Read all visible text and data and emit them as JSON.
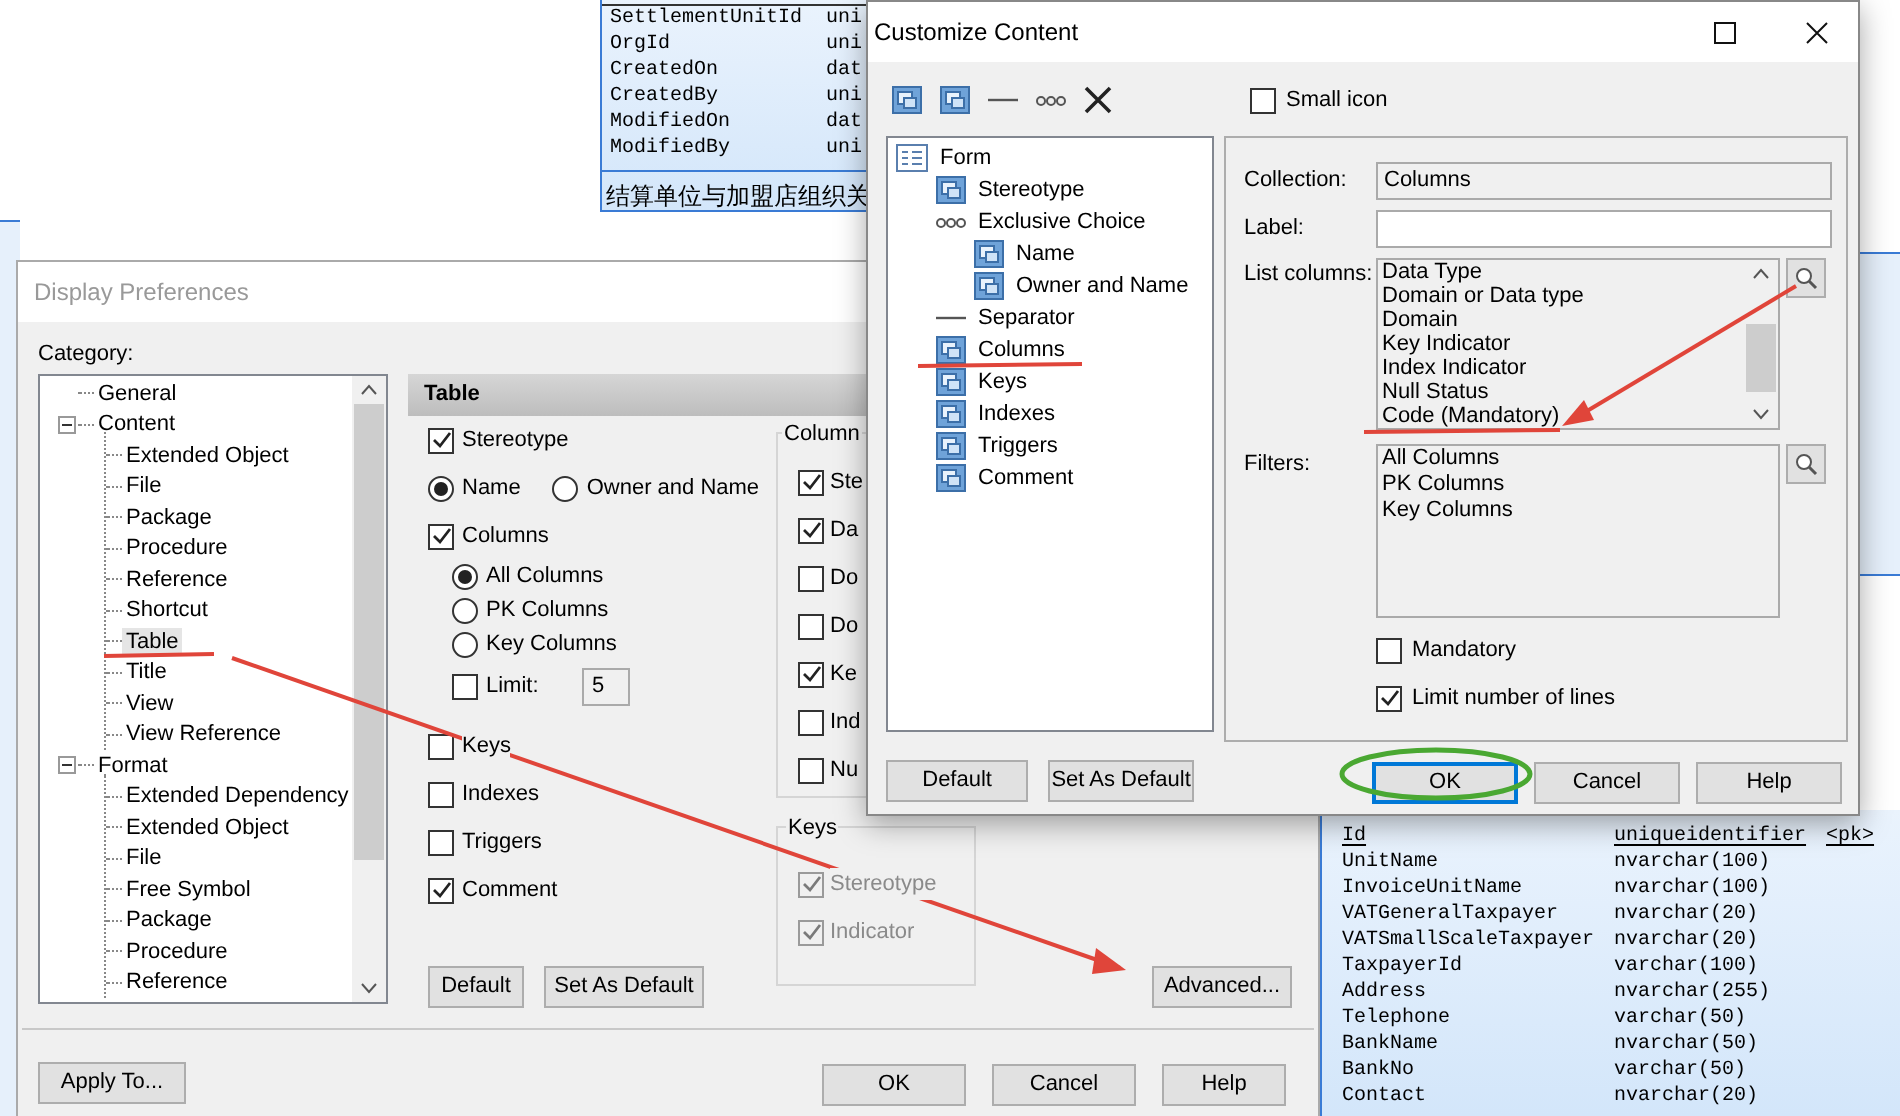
{
  "diagram_top_entity": {
    "rows": [
      {
        "name": "SettlementUnitId",
        "type": "uni"
      },
      {
        "name": "OrgId",
        "type": "uni"
      },
      {
        "name": "CreatedOn",
        "type": "dat"
      },
      {
        "name": "CreatedBy",
        "type": "uni"
      },
      {
        "name": "ModifiedOn",
        "type": "dat"
      },
      {
        "name": "ModifiedBy",
        "type": "uni"
      }
    ],
    "comment": "结算单位与加盟店组织关"
  },
  "diagram_bottom_entity": {
    "rows": [
      {
        "name": "Id",
        "type": "uniqueidentifier",
        "key": "<pk>"
      },
      {
        "name": "UnitName",
        "type": "nvarchar(100)"
      },
      {
        "name": "InvoiceUnitName",
        "type": "nvarchar(100)"
      },
      {
        "name": "VATGeneralTaxpayer",
        "type": "nvarchar(20)"
      },
      {
        "name": "VATSmallScaleTaxpayer",
        "type": "nvarchar(20)"
      },
      {
        "name": "TaxpayerId",
        "type": "varchar(100)"
      },
      {
        "name": "Address",
        "type": "nvarchar(255)"
      },
      {
        "name": "Telephone",
        "type": "varchar(50)"
      },
      {
        "name": "BankName",
        "type": "nvarchar(50)"
      },
      {
        "name": "BankNo",
        "type": "varchar(50)"
      },
      {
        "name": "Contact",
        "type": "nvarchar(20)"
      }
    ]
  },
  "display_preferences": {
    "title": "Display Preferences",
    "category_label": "Category:",
    "tree": [
      {
        "label": "General",
        "selected": false
      },
      {
        "label": "Content",
        "selected": false,
        "expanded": true,
        "children": [
          {
            "label": "Extended Object",
            "selected": false
          },
          {
            "label": "File",
            "selected": false
          },
          {
            "label": "Package",
            "selected": false
          },
          {
            "label": "Procedure",
            "selected": false
          },
          {
            "label": "Reference",
            "selected": false
          },
          {
            "label": "Shortcut",
            "selected": false
          },
          {
            "label": "Table",
            "selected": true
          },
          {
            "label": "Title",
            "selected": false
          },
          {
            "label": "View",
            "selected": false
          },
          {
            "label": "View Reference",
            "selected": false
          }
        ]
      },
      {
        "label": "Format",
        "selected": false,
        "expanded": true,
        "children": [
          {
            "label": "Extended Dependency",
            "selected": false
          },
          {
            "label": "Extended Object",
            "selected": false
          },
          {
            "label": "File",
            "selected": false
          },
          {
            "label": "Free Symbol",
            "selected": false
          },
          {
            "label": "Package",
            "selected": false
          },
          {
            "label": "Procedure",
            "selected": false
          },
          {
            "label": "Reference",
            "selected": false
          }
        ]
      }
    ],
    "panel_title": "Table",
    "options": [
      {
        "kind": "checkbox",
        "label": "Stereotype",
        "checked": true
      },
      {
        "kind": "radios",
        "options": [
          {
            "label": "Name",
            "selected": true
          },
          {
            "label": "Owner and Name",
            "selected": false
          }
        ]
      },
      {
        "kind": "checkbox",
        "label": "Columns",
        "checked": true,
        "children": [
          {
            "kind": "radio",
            "label": "All Columns",
            "selected": true
          },
          {
            "kind": "radio",
            "label": "PK Columns",
            "selected": false
          },
          {
            "kind": "radio",
            "label": "Key Columns",
            "selected": false
          },
          {
            "kind": "limit",
            "label": "Limit:",
            "checked": false,
            "value": "5"
          }
        ]
      },
      {
        "kind": "checkbox",
        "label": "Keys",
        "checked": false
      },
      {
        "kind": "checkbox",
        "label": "Indexes",
        "checked": false
      },
      {
        "kind": "checkbox",
        "label": "Triggers",
        "checked": false
      },
      {
        "kind": "checkbox",
        "label": "Comment",
        "checked": true
      }
    ],
    "column_group": {
      "label": "Column",
      "items": [
        {
          "label": "Ste",
          "checked": true
        },
        {
          "label": "Da",
          "checked": true
        },
        {
          "label": "Do",
          "checked": false
        },
        {
          "label": "Do",
          "checked": false
        },
        {
          "label": "Ke",
          "checked": true
        },
        {
          "label": "Ind",
          "checked": false
        },
        {
          "label": "Nu",
          "checked": false
        }
      ]
    },
    "keys_group": {
      "label": "Keys",
      "items": [
        {
          "label": "Stereotype",
          "checked": true,
          "disabled": true
        },
        {
          "label": "Indicator",
          "checked": true,
          "disabled": true
        }
      ]
    },
    "panel_buttons": [
      "Default",
      "Set As Default"
    ],
    "advanced_button": "Advanced...",
    "apply_button": "Apply To...",
    "footer_buttons": [
      "OK",
      "Cancel",
      "Help"
    ]
  },
  "customize_content": {
    "title": "Customize Content",
    "toolbar": [
      {
        "kind": "attribute"
      },
      {
        "kind": "attribute"
      },
      {
        "kind": "separator"
      },
      {
        "kind": "choice"
      },
      {
        "kind": "delete"
      }
    ],
    "small_icon": {
      "label": "Small icon",
      "checked": false
    },
    "tree": [
      {
        "label": "Form",
        "kind": "form",
        "children": [
          {
            "label": "Stereotype",
            "kind": "attribute"
          },
          {
            "label": "Exclusive Choice",
            "kind": "choice",
            "children": [
              {
                "label": "Name",
                "kind": "attribute"
              },
              {
                "label": "Owner and Name",
                "kind": "attribute"
              }
            ]
          },
          {
            "label": "Separator",
            "kind": "separator"
          },
          {
            "label": "Columns",
            "kind": "attribute"
          },
          {
            "label": "Keys",
            "kind": "attribute"
          },
          {
            "label": "Indexes",
            "kind": "attribute"
          },
          {
            "label": "Triggers",
            "kind": "attribute"
          },
          {
            "label": "Comment",
            "kind": "attribute"
          }
        ]
      }
    ],
    "collection": {
      "label": "Collection:",
      "value": "Columns"
    },
    "label_field": {
      "label": "Label:"
    },
    "list_columns": {
      "label": "List columns:",
      "items": [
        "Data Type",
        "Domain or Data type",
        "Domain",
        "Key Indicator",
        "Index Indicator",
        "Null Status",
        "Code (Mandatory)"
      ]
    },
    "filters": {
      "label": "Filters:",
      "items": [
        "All Columns",
        "PK Columns",
        "Key Columns"
      ]
    },
    "mandatory": {
      "label": "Mandatory",
      "checked": false
    },
    "limit_lines": {
      "label": "Limit number of lines",
      "checked": true
    },
    "left_buttons": [
      "Default",
      "Set As Default"
    ],
    "right_buttons": [
      {
        "label": "OK",
        "default": true
      },
      {
        "label": "Cancel",
        "default": false
      },
      {
        "label": "Help",
        "default": false
      }
    ]
  }
}
